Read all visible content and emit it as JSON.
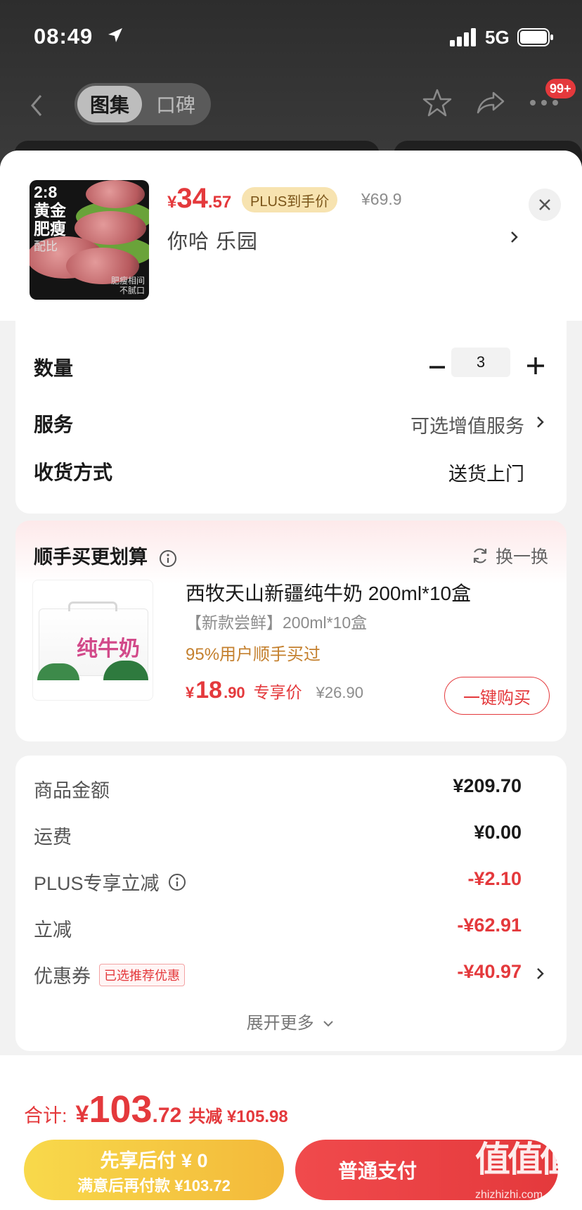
{
  "status_bar": {
    "time": "08:49",
    "network": "5G"
  },
  "nav": {
    "tab_active": "图集",
    "tab_inactive": "口碑",
    "badge": "99+"
  },
  "product": {
    "thumb_text_1": "2:8",
    "thumb_text_2": "黄金",
    "thumb_text_3": "肥瘦",
    "thumb_text_4": "配比",
    "thumb_note_1": "肥瘦相间",
    "thumb_note_2": "不腻口",
    "price_symbol": "¥",
    "price_int": "34",
    "price_dec": ".57",
    "plus_tag": "PLUS到手价",
    "original_price": "¥69.9",
    "spec": "你哈  乐园"
  },
  "options": {
    "quantity_label": "数量",
    "quantity_value": "3",
    "service_label": "服务",
    "service_value": "可选增值服务",
    "delivery_label": "收货方式",
    "delivery_value": "送货上门"
  },
  "recommend": {
    "title": "顺手买更划算",
    "swap": "换一换",
    "image_text": "纯牛奶",
    "name": "西牧天山新疆纯牛奶 200ml*10盒",
    "subtitle": "【新款尝鲜】200ml*10盒",
    "percent": "95%用户顺手买过",
    "price_symbol": "¥",
    "price_int": "18",
    "price_dec": ".90",
    "price_tag": "专享价",
    "original_price": "¥26.90",
    "buy_button": "一键购买"
  },
  "fees": {
    "goods_label": "商品金额",
    "goods_amount": "¥209.70",
    "shipping_label": "运费",
    "shipping_amount": "¥0.00",
    "plus_label": "PLUS专享立减",
    "plus_amount": "-¥2.10",
    "discount_label": "立减",
    "discount_amount": "-¥62.91",
    "coupon_label": "优惠券",
    "coupon_tag": "已选推荐优惠",
    "coupon_amount": "-¥40.97",
    "expand": "展开更多"
  },
  "footer": {
    "total_label": "合计:",
    "total_symbol": "¥",
    "total_int": "103",
    "total_dec": ".72",
    "saved": "共减 ¥105.98",
    "pay_later_title": "先享后付 ¥ 0",
    "pay_later_sub": "满意后再付款 ¥103.72",
    "pay_normal": "普通支付",
    "watermark": "值值值",
    "watermark_url": "zhizhizhi.com"
  },
  "colors": {
    "accent": "#e4393c",
    "gold": "#f3b93a",
    "plus_tag_bg": "#f7e3b0"
  }
}
